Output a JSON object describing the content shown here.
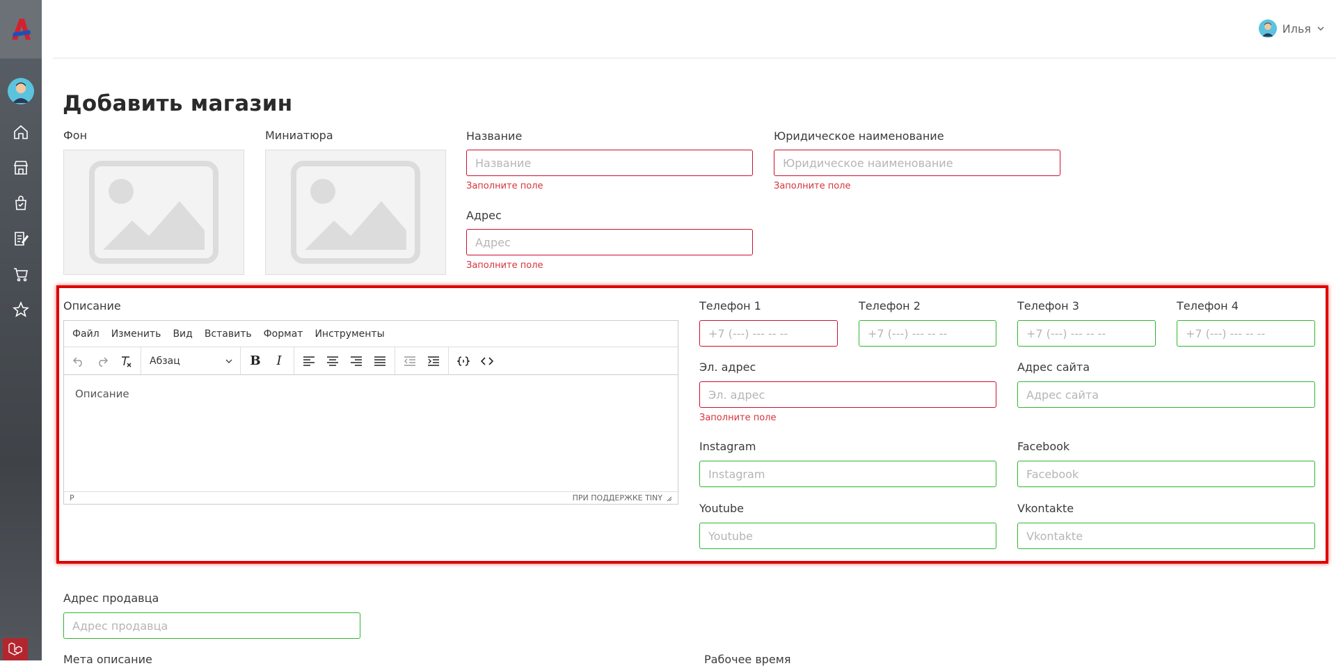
{
  "app": {
    "user_name": "Илья"
  },
  "page": {
    "title": "Добавить магазин"
  },
  "images": {
    "background_label": "Фон",
    "thumbnail_label": "Миниатюра"
  },
  "fields": {
    "name": {
      "label": "Название",
      "placeholder": "Название",
      "error": "Заполните поле"
    },
    "legal_name": {
      "label": "Юридическое наименование",
      "placeholder": "Юридическое наименование",
      "error": "Заполните поле"
    },
    "address": {
      "label": "Адрес",
      "placeholder": "Адрес",
      "error": "Заполните поле"
    },
    "phone1": {
      "label": "Телефон 1",
      "placeholder": "+7 (---) --- -- --"
    },
    "phone2": {
      "label": "Телефон 2",
      "placeholder": "+7 (---) --- -- --"
    },
    "phone3": {
      "label": "Телефон 3",
      "placeholder": "+7 (---) --- -- --"
    },
    "phone4": {
      "label": "Телефон 4",
      "placeholder": "+7 (---) --- -- --"
    },
    "email": {
      "label": "Эл. адрес",
      "placeholder": "Эл. адрес",
      "error": "Заполните поле"
    },
    "website": {
      "label": "Адрес сайта",
      "placeholder": "Адрес сайта"
    },
    "instagram": {
      "label": "Instagram",
      "placeholder": "Instagram"
    },
    "facebook": {
      "label": "Facebook",
      "placeholder": "Facebook"
    },
    "youtube": {
      "label": "Youtube",
      "placeholder": "Youtube"
    },
    "vkontakte": {
      "label": "Vkontakte",
      "placeholder": "Vkontakte"
    },
    "seller_address": {
      "label": "Адрес продавца",
      "placeholder": "Адрес продавца"
    },
    "meta_description": {
      "label": "Мета описание"
    },
    "work_time": {
      "label": "Рабочее время"
    }
  },
  "editor": {
    "label": "Описание",
    "menu": [
      "Файл",
      "Изменить",
      "Вид",
      "Вставить",
      "Формат",
      "Инструменты"
    ],
    "block_format": "Абзац",
    "content_placeholder": "Описание",
    "status_path": "P",
    "branding": "ПРИ ПОДДЕРЖКЕ TINY"
  },
  "colors": {
    "error": "#c8102e",
    "valid": "#2fb52f",
    "highlight": "#e00000"
  },
  "sidebar": {
    "icons": [
      "home-icon",
      "store-icon",
      "shopping-bag-icon",
      "edit-document-icon",
      "cart-icon",
      "star-icon"
    ]
  }
}
